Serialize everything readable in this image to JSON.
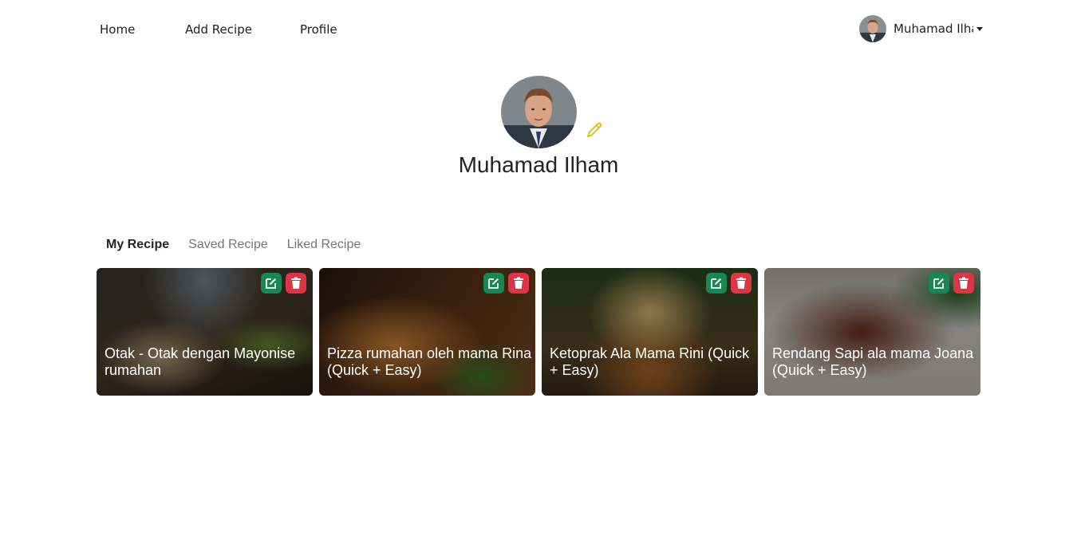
{
  "nav": {
    "items": [
      {
        "label": "Home"
      },
      {
        "label": "Add Recipe"
      },
      {
        "label": "Profile"
      }
    ],
    "user_name": "Muhamad Ilham"
  },
  "profile": {
    "name": "Muhamad Ilham"
  },
  "tabs": [
    {
      "label": "My Recipe",
      "active": true
    },
    {
      "label": "Saved Recipe",
      "active": false
    },
    {
      "label": "Liked Recipe",
      "active": false
    }
  ],
  "recipes": [
    {
      "title": "Otak - Otak dengan Mayonise rumahan"
    },
    {
      "title": "Pizza rumahan oleh mama Rina (Quick + Easy)"
    },
    {
      "title": "Ketoprak Ala Mama Rini (Quick + Easy)"
    },
    {
      "title": "Rendang Sapi ala mama Joana (Quick + Easy)"
    }
  ],
  "colors": {
    "edit_button": "#198754",
    "delete_button": "#dc3545",
    "edit_photo_icon": "#e0c21c"
  },
  "icons": {
    "edit": "edit-icon",
    "delete": "trash-icon",
    "edit_photo": "pencil-icon"
  }
}
